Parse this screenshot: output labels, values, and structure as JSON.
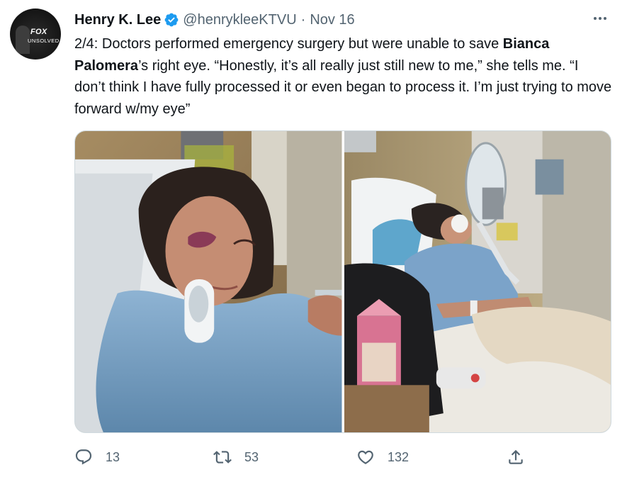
{
  "author": {
    "name": "Henry K. Lee",
    "handle": "@henryklee",
    "handle_suffix": "KTVU",
    "separator": "·",
    "date": "Nov 16",
    "avatar_text": {
      "top": "FOX",
      "bottom": "UNSOLVED"
    }
  },
  "tweet": {
    "parts": [
      "2/4: Doctors performed emergency surgery but were unable to save ",
      "Bianca Palomera",
      "’s right eye. “Honestly, it’s all really just still new to me,” she tells me. “I don’t think I have fully processed it or even began to process it. I’m just trying to move forward w/my eye”"
    ]
  },
  "media": {
    "images": [
      {
        "icon": "photo-patient-closeup"
      },
      {
        "icon": "photo-patient-hospital-bed"
      }
    ]
  },
  "actions": {
    "reply_count": "13",
    "retweet_count": "53",
    "like_count": "132"
  },
  "colors": {
    "text": "#0f1419",
    "secondary": "#536471",
    "verified": "#1d9bf0",
    "border": "#cfd9de"
  }
}
